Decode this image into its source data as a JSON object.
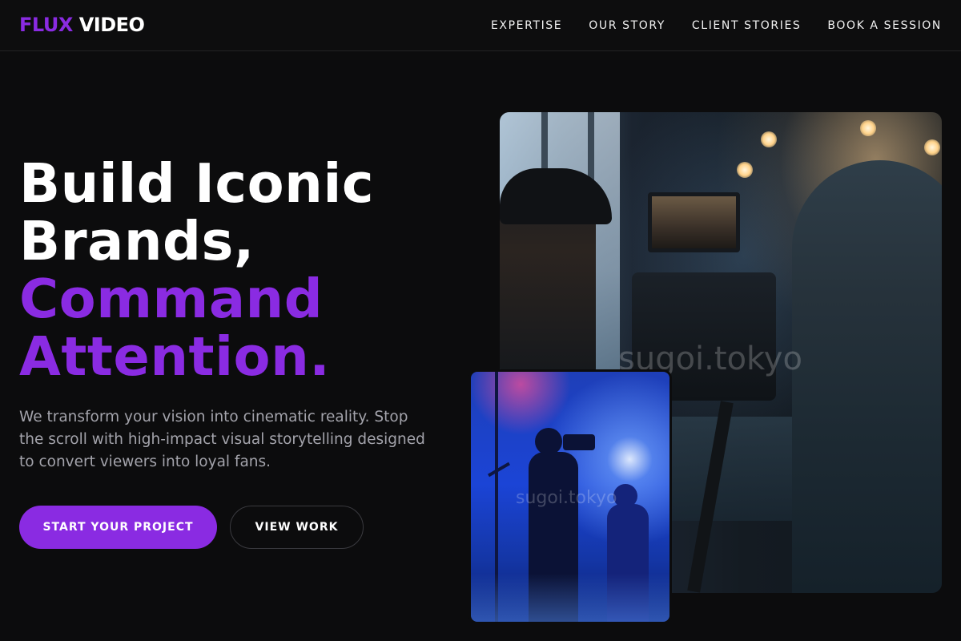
{
  "brand": {
    "accent_word": "FLUX",
    "plain_word": "VIDEO",
    "accent_color": "#8a2be2"
  },
  "nav": {
    "items": [
      {
        "label": "EXPERTISE"
      },
      {
        "label": "OUR STORY"
      },
      {
        "label": "CLIENT STORIES"
      },
      {
        "label": "BOOK A SESSION"
      }
    ]
  },
  "hero": {
    "title_lines": [
      {
        "text": "Build Iconic",
        "color": "#ffffff"
      },
      {
        "text": "Brands,",
        "color": "#ffffff"
      },
      {
        "text": "Command",
        "color": "#8a2be2"
      },
      {
        "text": "Attention.",
        "color": "#8a2be2"
      }
    ],
    "subtitle": "We transform your vision into cinematic reality. Stop the scroll with high-impact visual storytelling designed to convert viewers into loyal fans.",
    "primary_cta": "START YOUR PROJECT",
    "secondary_cta": "VIEW WORK"
  },
  "images": {
    "main_watermark": "sugoi.tokyo",
    "inset_watermark": "sugoi.tokyo"
  }
}
